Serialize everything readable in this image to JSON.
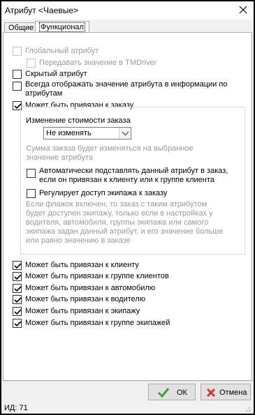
{
  "window": {
    "title": "Атрибут <Чаевые>"
  },
  "tabs": [
    {
      "label": "Общие",
      "active": false
    },
    {
      "label": "Функционал",
      "active": true
    }
  ],
  "options": {
    "global_attr": "Глобальный атрибут",
    "pass_tmdriver": "Передавать значение в TMDriver",
    "hidden_attr": "Скрытый атрибут",
    "always_show": "Всегда отображать значение атрибута в информации по атрибутам",
    "bind_order": "Может быть привязан к заказу"
  },
  "order_group": {
    "cost_change_label": "Изменение стоимости заказа",
    "cost_change_value": "Не изменять",
    "cost_change_hint": "Сумма заказа будет изменяться на выбранное значение атрибута",
    "auto_substitute": "Автоматически подставлять данный атрибут в заказ, если он привязан к клиенту или к группе клиента",
    "crew_access": "Регулирует доступ экипажа к заказу",
    "crew_access_hint": "Если флажок включен, то заказ с таким атрибутом будет доступен экипажу, только если в настройках у водителя, автомобиля, группы экипажа или самого экипажа задан данный атрибут, и его значение больше или равно значению в заказе"
  },
  "bindings": [
    "Может быть привязан к клиенту",
    "Может быть привязан к группе клиентов",
    "Может быть привязан к автомобилю",
    "Может быть привязан к водителю",
    "Может быть привязан к экипажу",
    "Может быть привязан к группе экипажей"
  ],
  "buttons": {
    "ok": "ОК",
    "cancel": "Отмена"
  },
  "status": {
    "id_text": "ИД: 71"
  },
  "colors": {
    "ok_check": "#3aa335",
    "cancel_x": "#d9312b",
    "disabled_text": "#9a9a9a"
  }
}
